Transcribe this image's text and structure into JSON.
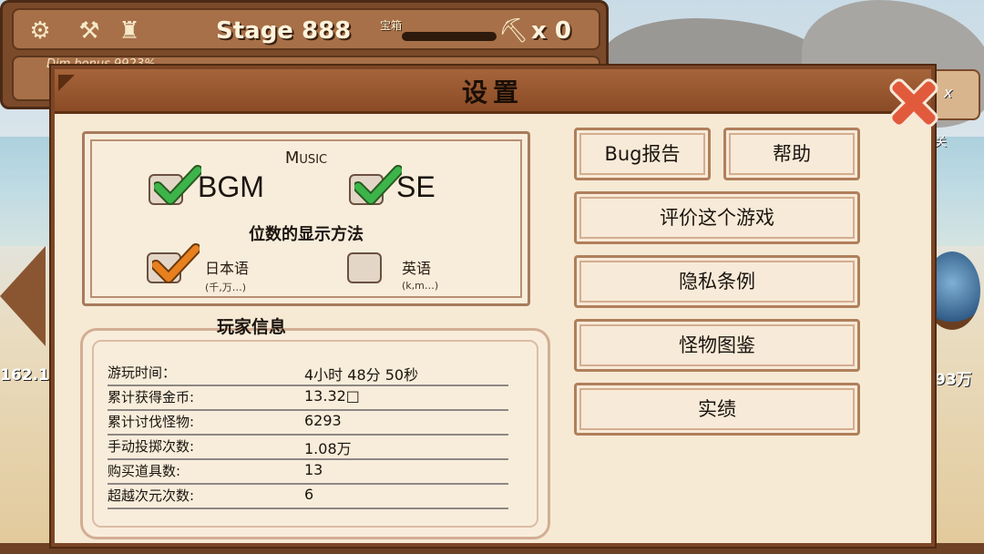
{
  "hud": {
    "stage": "Stage 888",
    "chest_label": "宝箱",
    "pickaxe_count": "x 0",
    "dim_bonus": "Dim bonus  9923%",
    "left_value": "162.1",
    "right_value": "93万",
    "right_button_text": "x",
    "right_small_text": "关"
  },
  "dialog": {
    "title": "设置"
  },
  "settings": {
    "music_title": "Music",
    "bgm_label": "BGM",
    "se_label": "SE",
    "bgm_checked": true,
    "se_checked": true,
    "digit_title": "位数的显示方法",
    "japanese_label": "日本语",
    "japanese_sub": "(千,万…)",
    "english_label": "英语",
    "english_sub": "(k,m…)",
    "japanese_checked": true,
    "english_checked": false
  },
  "player_info": {
    "title": "玩家信息",
    "rows": [
      {
        "key": "游玩时间：",
        "value": "4小时 48分 50秒"
      },
      {
        "key": "累计获得金币:",
        "value": "13.32□"
      },
      {
        "key": "累计讨伐怪物:",
        "value": "6293"
      },
      {
        "key": "手动投掷次数:",
        "value": "1.08万"
      },
      {
        "key": "购买道具数:",
        "value": "13"
      },
      {
        "key": "超越次元次数:",
        "value": "6"
      }
    ]
  },
  "buttons": {
    "bug_report": "Bug报告",
    "help": "帮助",
    "rate_game": "评价这个游戏",
    "privacy": "隐私条例",
    "monster_book": "怪物图鉴",
    "achievements": "实绩"
  },
  "icons": {
    "close": "close-x-icon",
    "gear": "gear-icon",
    "hammer": "hammer-icon",
    "pickaxe": "pickaxe-icon"
  },
  "colors": {
    "check_green": "#3cb44a",
    "check_orange": "#e8801e",
    "close_red": "#e25a3c"
  }
}
